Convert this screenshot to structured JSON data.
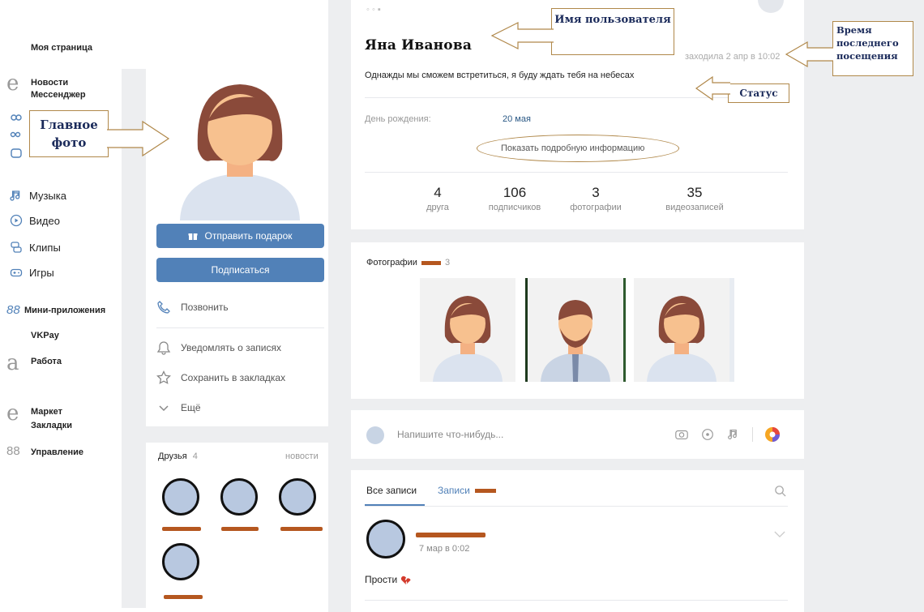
{
  "nav": {
    "my_page": "Моя страница",
    "news": "Новости",
    "messenger": "Мессенджер",
    "music": "Музыка",
    "video": "Видео",
    "clips": "Клипы",
    "games": "Игры",
    "mini_apps": "Мини-приложения",
    "vkpay": "VKPay",
    "work": "Работа",
    "market": "Маркет",
    "bookmarks": "Закладки",
    "manage": "Управление"
  },
  "profile": {
    "name": "Яна Иванова",
    "last_seen": "заходила 2 апр в 10:02",
    "status": "Однажды мы сможем встретиться, я буду ждать тебя на небесах",
    "birthday_label": "День рождения:",
    "birthday_value": "20 мая",
    "more_info": "Показать подробную информацию",
    "stats": [
      {
        "n": "4",
        "l": "друга"
      },
      {
        "n": "106",
        "l": "подписчиков"
      },
      {
        "n": "3",
        "l": "фотографии"
      },
      {
        "n": "35",
        "l": "видеозаписей"
      }
    ]
  },
  "actions": {
    "gift": "Отправить подарок",
    "subscribe": "Подписаться",
    "call": "Позвонить",
    "notify": "Уведомлять о записях",
    "save": "Сохранить в закладках",
    "more": "Ещё"
  },
  "friends": {
    "label": "Друзья",
    "count": "4",
    "link": "новости"
  },
  "photos": {
    "label": "Фотографии",
    "count": "3"
  },
  "composer": {
    "placeholder": "Напишите что-нибудь..."
  },
  "wall": {
    "tab_all": "Все записи",
    "tab_own": "Записи",
    "post_date": "7 мар в 0:02",
    "post_text": "Прости"
  },
  "callouts": {
    "main_photo": "Главное фото",
    "username": "Имя пользователя",
    "last_visit": "Время последнего посещения",
    "status": "Статус"
  },
  "colors": {
    "accent": "#5181b8",
    "callout_border": "#b0884a",
    "callout_text": "#1a2a5a",
    "redaction": "#b5571f"
  }
}
